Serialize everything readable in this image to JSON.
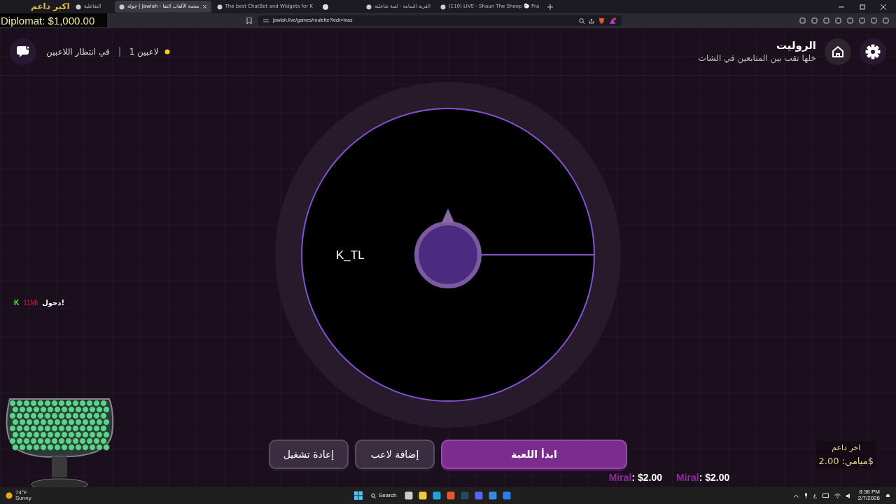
{
  "browser": {
    "tabs": [
      {
        "label": "(110) LIVE - Shaun The Sheep 🐑 Pra",
        "selected": false
      },
      {
        "label": "القرية السامة - لعبة تفاعلية",
        "selected": false
      },
      {
        "selected": false
      },
      {
        "label": "The best ChatBot and Widgets for K",
        "selected": false
      },
      {
        "label": "جولة | Jawlah - منصة الألعاب التفا",
        "selected": true
      },
      {
        "label": "التفاعلية",
        "selected": false
      }
    ],
    "url": "jawlah.live/games/roulette?kick=inas"
  },
  "overlay": {
    "top_donor_title": "اكبر داعم",
    "top_donor": "Diplomat: $1,000.00",
    "last_donor_title": "اخر داعم",
    "last_donor": "ميامي: 2.00$",
    "chat": {
      "badge": "K",
      "user": "11Mi",
      "message": "دخول!"
    }
  },
  "header": {
    "title": "الروليت",
    "subtitle": "خلها تقب بين المتابعين في الشات",
    "players": "1 لاعبين",
    "status": "في انتظار اللاعبين"
  },
  "wheel": {
    "segments": [
      {
        "label": "K_TL"
      }
    ]
  },
  "buttons": [
    {
      "label": "ابدأ اللعبة",
      "kind": "primary"
    },
    {
      "label": "إضافة لاعب",
      "kind": "secondary"
    },
    {
      "label": "إعادة تشغيل",
      "kind": "secondary"
    }
  ],
  "donations": [
    {
      "name": "Miral",
      "amount": ": $2.00"
    },
    {
      "name": "Miral",
      "amount": ": $2.00"
    }
  ],
  "taskbar": {
    "temperature": "74°F",
    "weather": "Sunny",
    "search": "Search",
    "language": "ع",
    "time": "8:38 PM",
    "date": "2/7/2026"
  }
}
